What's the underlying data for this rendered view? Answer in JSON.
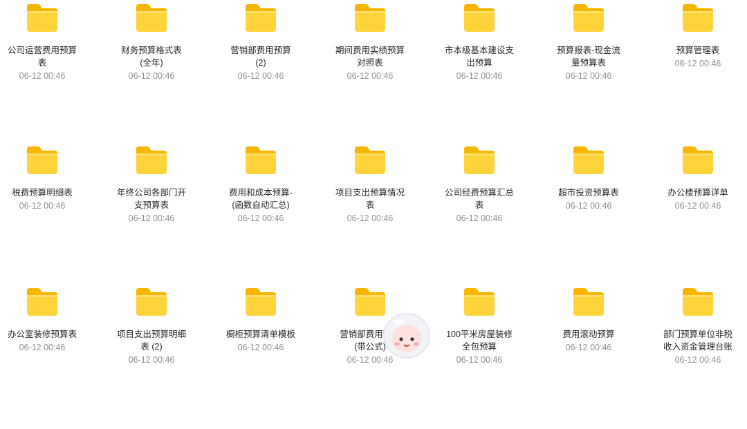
{
  "files": [
    {
      "name": "公司运营费用预算表",
      "date": "06-12 00:46",
      "icon": "folder-icon"
    },
    {
      "name": "财务预算格式表(全年)",
      "date": "06-12 00:46",
      "icon": "folder-icon"
    },
    {
      "name": "营销部费用预算 (2)",
      "date": "06-12 00:46",
      "icon": "folder-icon"
    },
    {
      "name": "期间费用实绩预算对照表",
      "date": "06-12 00:46",
      "icon": "folder-icon"
    },
    {
      "name": "市本级基本建设支出预算",
      "date": "06-12 00:46",
      "icon": "folder-icon"
    },
    {
      "name": "预算报表-现金流量预算表",
      "date": "06-12 00:46",
      "icon": "folder-icon"
    },
    {
      "name": "预算管理表",
      "date": "06-12 00:46",
      "icon": "folder-icon"
    },
    {
      "name": "税费预算明细表",
      "date": "06-12 00:46",
      "icon": "folder-icon"
    },
    {
      "name": "年终公司各部门开支预算表",
      "date": "06-12 00:46",
      "icon": "folder-icon"
    },
    {
      "name": "费用和成本预算-(函数自动汇总)",
      "date": "06-12 00:46",
      "icon": "folder-icon"
    },
    {
      "name": "项目支出预算情况表",
      "date": "06-12 00:46",
      "icon": "folder-icon"
    },
    {
      "name": "公司经费预算汇总表",
      "date": "06-12 00:46",
      "icon": "folder-icon"
    },
    {
      "name": "超市投资预算表",
      "date": "06-12 00:46",
      "icon": "folder-icon"
    },
    {
      "name": "办公楼预算详单",
      "date": "06-12 00:46",
      "icon": "folder-icon"
    },
    {
      "name": "办公室装修预算表",
      "date": "06-12 00:46",
      "icon": "folder-icon"
    },
    {
      "name": "项目支出预算明细表 (2)",
      "date": "06-12 00:46",
      "icon": "folder-icon"
    },
    {
      "name": "橱柜预算清单模板",
      "date": "06-12 00:46",
      "icon": "folder-icon"
    },
    {
      "name": "营销部费用预算(带公式)",
      "date": "06-12 00:46",
      "icon": "folder-icon"
    },
    {
      "name": "100平米房屋装修全包预算",
      "date": "06-12 00:46",
      "icon": "folder-icon"
    },
    {
      "name": "费用滚动预算",
      "date": "06-12 00:46",
      "icon": "folder-icon"
    },
    {
      "name": "部门预算单位非税收入资金管理台账",
      "date": "06-12 00:46",
      "icon": "folder-icon"
    }
  ],
  "colors": {
    "folder_back": "#f7b500",
    "folder_front": "#ffd43b",
    "text": "#1f2329",
    "date": "#8a8f99"
  },
  "assistant": {
    "icon": "mascot-icon"
  }
}
